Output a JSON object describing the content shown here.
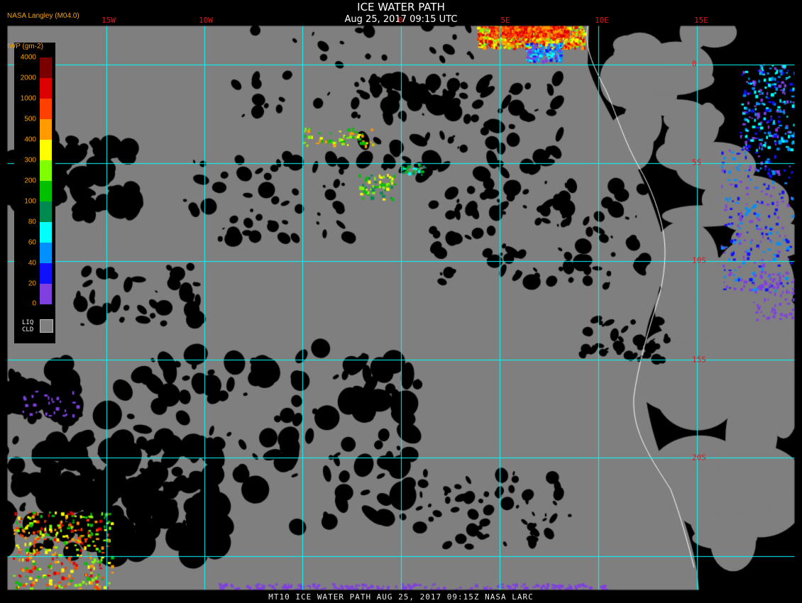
{
  "header": {
    "title": "ICE WATER PATH",
    "timestamp": "Aug 25, 2017 09:15 UTC",
    "source": "NASA Langley (M04.0)"
  },
  "footer": {
    "caption": "MT10  ICE WATER PATH   AUG 25, 2017 09:15Z   NASA LARC"
  },
  "map": {
    "lon_labels": [
      "15W",
      "10W",
      "0",
      "5E",
      "10E",
      "15E"
    ],
    "lat_labels": [
      "0",
      "5S",
      "10S",
      "15S",
      "20S"
    ],
    "colors": {
      "background": "#000000",
      "cloud": "#7f7f7f",
      "grid": "#00ffff",
      "coast": "#ffffff",
      "grid_label": "#e0151e"
    }
  },
  "legend": {
    "title": "IWP (gm-2)",
    "values": [
      "4000",
      "2000",
      "1000",
      "500",
      "400",
      "300",
      "200",
      "100",
      "80",
      "60",
      "40",
      "20",
      "0"
    ],
    "colors": [
      "#7a0000",
      "#dd0000",
      "#ff4000",
      "#ff9a00",
      "#ffff00",
      "#80ff00",
      "#00c000",
      "#008a50",
      "#00ffff",
      "#0090ff",
      "#1010ff",
      "#8040e0"
    ],
    "liq_label_1": "LIQ",
    "liq_label_2": "CLD",
    "liq_color": "#7f7f7f"
  }
}
